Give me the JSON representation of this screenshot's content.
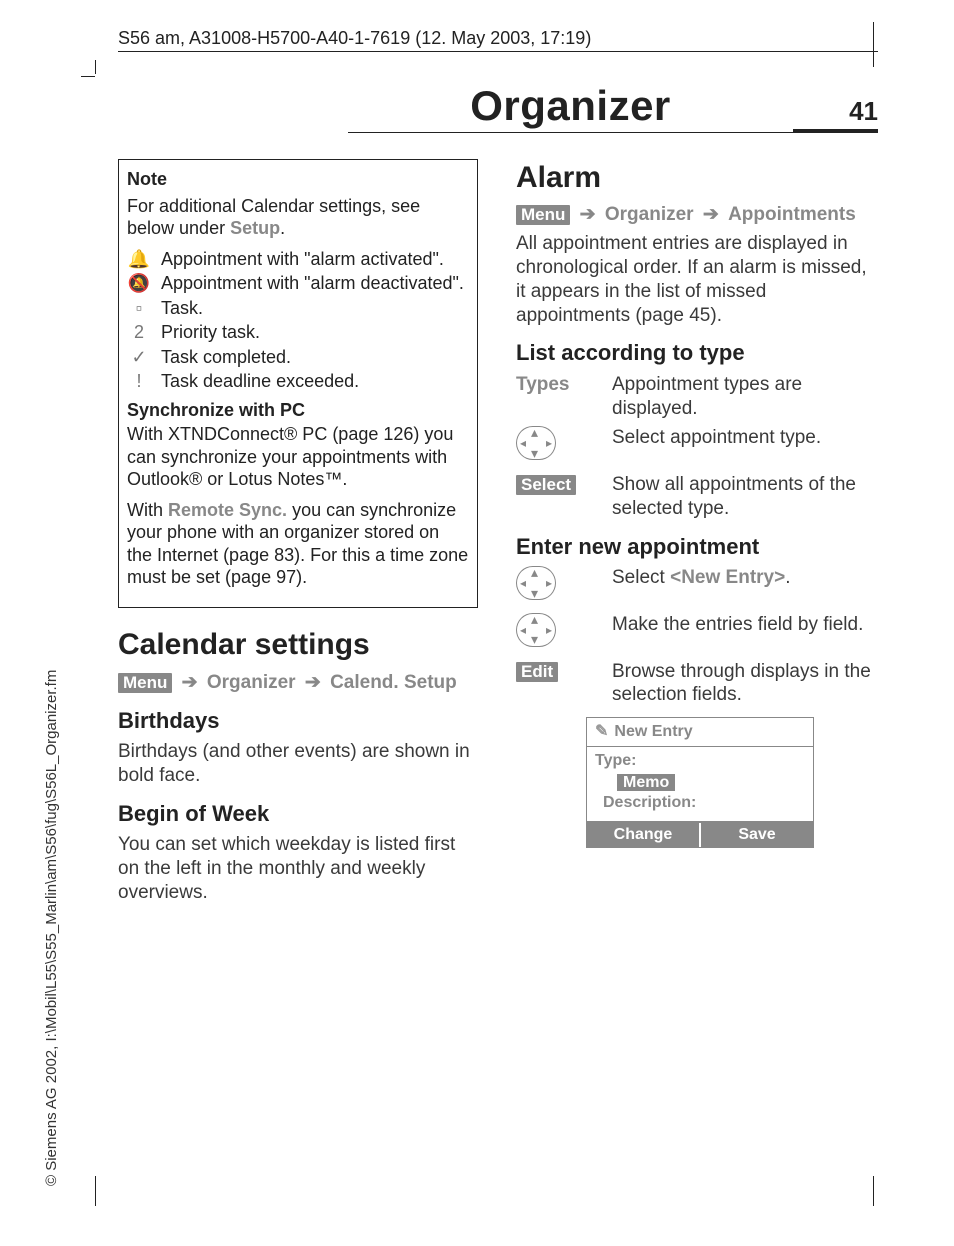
{
  "header_line": "S56 am, A31008-H5700-A40-1-7619 (12. May 2003, 17:19)",
  "spine": "© Siemens AG 2002, I:\\Mobil\\L55\\S55_Marlin\\am\\S56\\fug\\S56L_Organizer.fm",
  "page_title": "Organizer",
  "page_number": "41",
  "left": {
    "note_heading": "Note",
    "note_intro_a": "For additional Calendar settings, see below under ",
    "note_intro_b": "Setup",
    "note_intro_c": ".",
    "icons": [
      {
        "glyph": "🔔",
        "text": "Appointment with \"alarm activated\"."
      },
      {
        "glyph": "🔕",
        "text": "Appointment with \"alarm deactivated\"."
      },
      {
        "glyph": "▫",
        "text": "Task."
      },
      {
        "glyph": "2",
        "text": "Priority task."
      },
      {
        "glyph": "✓",
        "text": "Task completed."
      },
      {
        "glyph": "!",
        "text": "Task deadline exceeded."
      }
    ],
    "sync_heading": "Synchronize with PC",
    "sync_p1": "With XTNDConnect® PC (page 126) you can synchronize your appointments with Outlook® or Lotus Notes™.",
    "sync_p2_a": "With ",
    "sync_p2_link": "Remote Sync.",
    "sync_p2_b": " you can synchronize your phone with an organizer stored on the Internet (page 83). For this a time zone must be set (page 97).",
    "h1": "Calendar settings",
    "menu_chip": "Menu",
    "path1": "Organizer",
    "path2": "Calend. Setup",
    "h2a": "Birthdays",
    "p_birth": "Birthdays (and other events) are shown in bold face.",
    "h2b": "Begin of Week",
    "p_week": "You can set which weekday is listed first on the left in the monthly and weekly overviews."
  },
  "right": {
    "h1": "Alarm",
    "menu_chip": "Menu",
    "path1": "Organizer",
    "path2": "Appointments",
    "intro": "All appointment entries are displayed in chronological order. If an alarm is missed, it appears in the list of missed appointments (page 45).",
    "h2a": "List according to type",
    "types_label": "Types",
    "types_text": "Appointment types are displayed.",
    "nav_text": "Select appointment type.",
    "select_chip": "Select",
    "select_text": "Show all appointments of the selected type.",
    "h2b": "Enter new appointment",
    "nav2_a": "Select ",
    "nav2_b": "<New Entry>",
    "nav2_c": ".",
    "nav3_text": "Make the entries field by field.",
    "edit_chip": "Edit",
    "edit_text": "Browse through displays in the selection fields.",
    "phone": {
      "title": "New Entry",
      "type_label": "Type:",
      "memo_value": "Memo",
      "desc_label": "Description:",
      "btn_left": "Change",
      "btn_right": "Save"
    }
  }
}
